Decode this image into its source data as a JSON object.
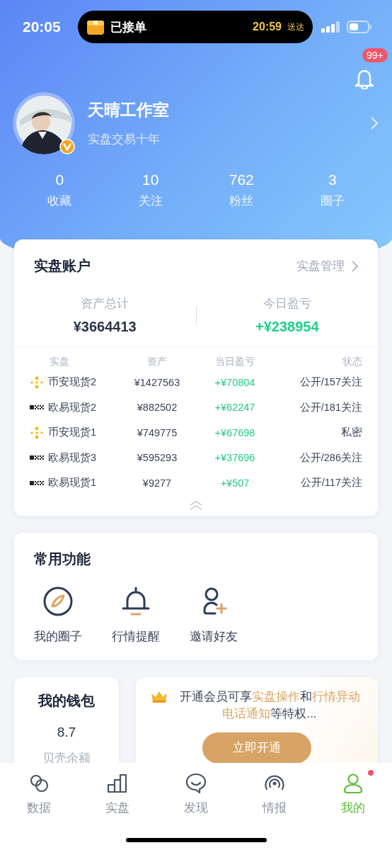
{
  "status_bar": {
    "time": "20:05",
    "island": {
      "label": "已接单",
      "eta": "20:59",
      "eta_suffix": "送达"
    }
  },
  "notifications": {
    "badge": "99+"
  },
  "profile": {
    "name": "天晴工作室",
    "bio": "实盘交易十年",
    "verified": true
  },
  "stats": [
    {
      "value": "0",
      "label": "收藏"
    },
    {
      "value": "10",
      "label": "关注"
    },
    {
      "value": "762",
      "label": "粉丝"
    },
    {
      "value": "3",
      "label": "圈子"
    }
  ],
  "account": {
    "title": "实盘账户",
    "link": "实盘管理",
    "summary": [
      {
        "label": "资产总计",
        "value": "¥3664413",
        "kind": "total"
      },
      {
        "label": "今日盈亏",
        "value": "+¥238954",
        "kind": "gain"
      }
    ],
    "columns": [
      "实盘",
      "资产",
      "当日盈亏",
      "状态"
    ],
    "rows": [
      {
        "kind": "binance",
        "name": "币安现货2",
        "assets": "¥1427563",
        "pnl": "+¥70804",
        "status": "公开/157关注"
      },
      {
        "kind": "okx",
        "name": "欧易现货2",
        "assets": "¥882502",
        "pnl": "+¥62247",
        "status": "公开/181关注"
      },
      {
        "kind": "binance",
        "name": "币安现货1",
        "assets": "¥749775",
        "pnl": "+¥67698",
        "status": "私密"
      },
      {
        "kind": "okx",
        "name": "欧易现货3",
        "assets": "¥595293",
        "pnl": "+¥37696",
        "status": "公开/286关注"
      },
      {
        "kind": "okx",
        "name": "欧易现货1",
        "assets": "¥9277",
        "pnl": "+¥507",
        "status": "公开/117关注"
      }
    ]
  },
  "functions": {
    "title": "常用功能",
    "items": [
      {
        "kind": "circle",
        "label": "我的圈子"
      },
      {
        "kind": "alert",
        "label": "行情提醒"
      },
      {
        "kind": "invite",
        "label": "邀请好友"
      }
    ]
  },
  "wallet": {
    "title": "我的钱包",
    "value": "8.7",
    "label": "贝壳余额"
  },
  "vip": {
    "text": [
      {
        "text": "开通会员可享",
        "highlight": false
      },
      {
        "text": "实盘操作",
        "highlight": true
      },
      {
        "text": "和",
        "highlight": false
      },
      {
        "text": "行情异动电话通知",
        "highlight": true
      },
      {
        "text": "等特权...",
        "highlight": false
      }
    ],
    "button": "立即开通"
  },
  "tabs": [
    {
      "kind": "data",
      "label": "数据",
      "selected": false,
      "dot": false
    },
    {
      "kind": "chart",
      "label": "实盘",
      "selected": false,
      "dot": false
    },
    {
      "kind": "discover",
      "label": "发现",
      "selected": false,
      "dot": false
    },
    {
      "kind": "radar",
      "label": "情报",
      "selected": false,
      "dot": false
    },
    {
      "kind": "me",
      "label": "我的",
      "selected": true,
      "dot": true
    }
  ]
}
